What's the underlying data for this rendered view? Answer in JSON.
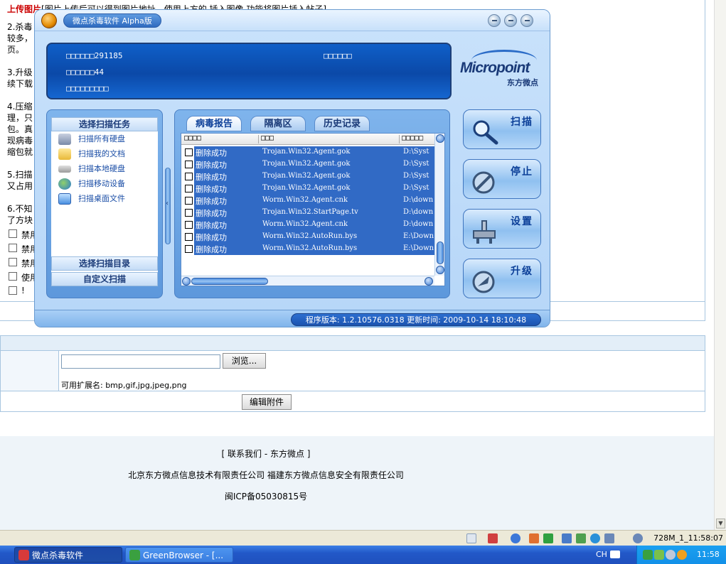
{
  "background_page": {
    "upload_title": "上传图片",
    "upload_hint": "[图片上传后可以得到图片地址，使用上方的 插入图像 功能将图片插入帖子]",
    "notes": [
      "2.杀毒",
      "较多，",
      "页。",
      "3.升级",
      "续下载",
      "4.压缩",
      "理，只",
      "包。真",
      "现病毒",
      "缩包就",
      "5.扫描",
      "又占用",
      "6.不知",
      "了方块"
    ],
    "checkboxes": [
      "禁用",
      "禁用",
      "禁用",
      "使用",
      "!"
    ],
    "browse_label": "浏览...",
    "ext_text": "可用扩展名: bmp,gif,jpg,jpeg,png",
    "edit_attach_label": "编辑附件",
    "footer_links": "[ 联系我们 - 东方微点 ]",
    "footer_company": "北京东方微点信息技术有限责任公司 福建东方微点信息安全有限责任公司",
    "footer_icp": "闽ICP备05030815号"
  },
  "statusbar": {
    "time_text": "728M_1_11:58:07"
  },
  "taskbar": {
    "tasks": [
      {
        "label": "微点杀毒软件",
        "active": true
      },
      {
        "label": "GreenBrowser - [...",
        "active": false
      }
    ],
    "language": "CH",
    "clock": "11:58"
  },
  "av_window": {
    "title": "微点杀毒软件 Alpha版",
    "info": {
      "line1": "□□□□□□291185",
      "line2": "□□□□□□44",
      "line3": "□□□□□□□□□",
      "right": "□□□□□□"
    },
    "logo": {
      "word": "Micropoint",
      "cn": "东方微点"
    },
    "left_panel": {
      "head": "选择扫描任务",
      "items": [
        {
          "label": "扫描所有硬盘",
          "icon": "hard-disk-icon"
        },
        {
          "label": "扫描我的文档",
          "icon": "folder-icon"
        },
        {
          "label": "扫描本地硬盘",
          "icon": "local-disk-icon"
        },
        {
          "label": "扫描移动设备",
          "icon": "globe-icon"
        },
        {
          "label": "扫描桌面文件",
          "icon": "desktop-icon"
        }
      ],
      "dir_label": "选择扫描目录",
      "custom_label": "自定义扫描"
    },
    "tabs": [
      "病毒报告",
      "隔离区",
      "历史记录"
    ],
    "list": {
      "headers": [
        "□□□□",
        "□□□",
        "□□□□□"
      ],
      "rows": [
        {
          "status": "删除成功",
          "virus": "Trojan.Win32.Agent.gok",
          "path": "D:\\Syst"
        },
        {
          "status": "删除成功",
          "virus": "Trojan.Win32.Agent.gok",
          "path": "D:\\Syst"
        },
        {
          "status": "删除成功",
          "virus": "Trojan.Win32.Agent.gok",
          "path": "D:\\Syst"
        },
        {
          "status": "删除成功",
          "virus": "Trojan.Win32.Agent.gok",
          "path": "D:\\Syst"
        },
        {
          "status": "删除成功",
          "virus": "Worm.Win32.Agent.cnk",
          "path": "D:\\down"
        },
        {
          "status": "删除成功",
          "virus": "Trojan.Win32.StartPage.tv",
          "path": "D:\\down"
        },
        {
          "status": "删除成功",
          "virus": "Worm.Win32.Agent.cnk",
          "path": "D:\\down"
        },
        {
          "status": "删除成功",
          "virus": "Worm.Win32.AutoRun.bys",
          "path": "E:\\Down"
        },
        {
          "status": "删除成功",
          "virus": "Worm.Win32.AutoRun.bys",
          "path": "E:\\Down"
        }
      ]
    },
    "actions": [
      {
        "label": "扫描",
        "icon": "magnifier-icon"
      },
      {
        "label": "停止",
        "icon": "stop-icon"
      },
      {
        "label": "设置",
        "icon": "settings-icon"
      },
      {
        "label": "升级",
        "icon": "upgrade-icon"
      }
    ],
    "version_text": "程序版本: 1.2.10576.0318  更新时间: 2009-10-14 18:10:48"
  }
}
